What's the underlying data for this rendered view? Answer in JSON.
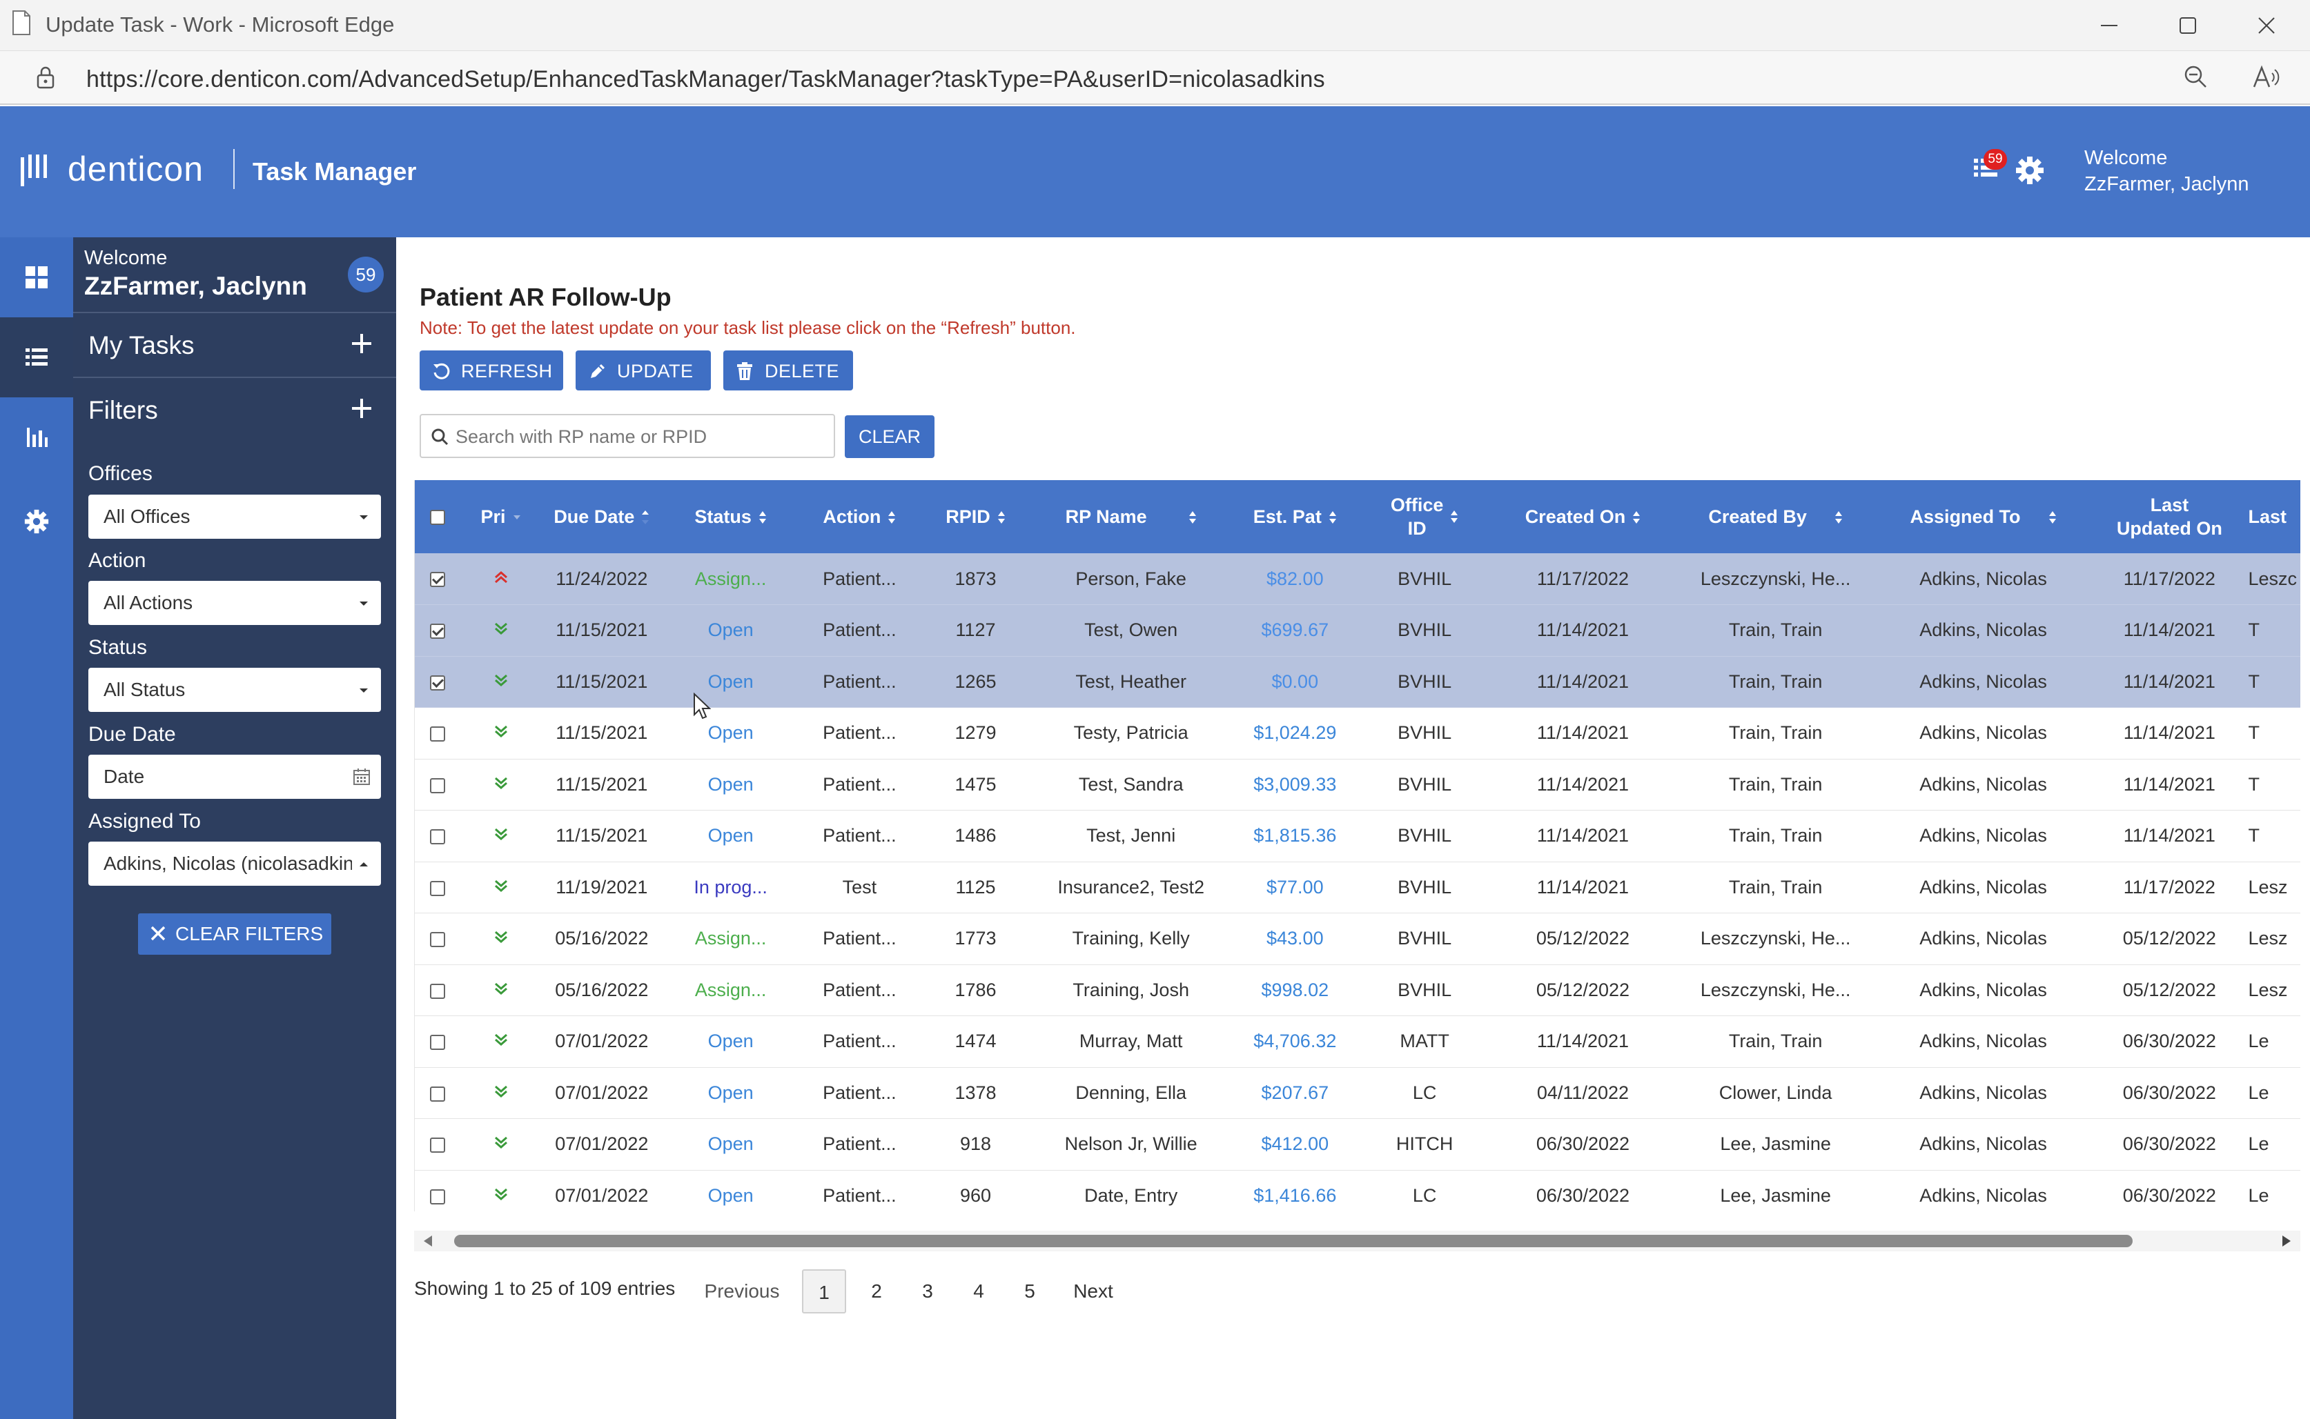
{
  "browser": {
    "window_title": "Update Task - Work - Microsoft Edge",
    "url": "https://core.denticon.com/AdvancedSetup/EnhancedTaskManager/TaskManager?taskType=PA&userID=nicolasadkins"
  },
  "header": {
    "logo_text": "denticon",
    "app_title": "Task Manager",
    "task_badge": "59",
    "welcome_line1": "Welcome",
    "welcome_line2": "ZzFarmer, Jaclynn"
  },
  "sidebar": {
    "welcome": "Welcome",
    "user_name": "ZzFarmer, Jaclynn",
    "count": "59",
    "my_tasks": "My Tasks",
    "filters": "Filters",
    "offices_label": "Offices",
    "offices_value": "All Offices",
    "action_label": "Action",
    "action_value": "All Actions",
    "status_label": "Status",
    "status_value": "All Status",
    "due_date_label": "Due Date",
    "due_date_placeholder": "Date",
    "assigned_label": "Assigned To",
    "assigned_value": "Adkins, Nicolas (nicolasadkins)",
    "clear_filters": "CLEAR FILTERS"
  },
  "main": {
    "title": "Patient AR Follow-Up",
    "note": "Note: To get the latest update on your task list please click on the “Refresh” button.",
    "refresh_label": "REFRESH",
    "update_label": "UPDATE",
    "delete_label": "DELETE",
    "search_placeholder": "Search with RP name or RPID",
    "clear_label": "CLEAR"
  },
  "table": {
    "columns": {
      "pri": "Pri",
      "due_date": "Due Date",
      "status": "Status",
      "action": "Action",
      "rpid": "RPID",
      "rp_name": "RP Name",
      "est_pat": "Est. Pat",
      "office_id_1": "Office",
      "office_id_2": "ID",
      "created_on": "Created On",
      "created_by": "Created By",
      "assigned_to": "Assigned To",
      "last_updated_1": "Last",
      "last_updated_2": "Updated On",
      "last": "Last"
    },
    "rows": [
      {
        "checked": true,
        "priority": "high",
        "due": "11/24/2022",
        "status": "Assign...",
        "status_type": "assign",
        "action": "Patient...",
        "rpid": "1873",
        "name": "Person, Fake",
        "est": "$82.00",
        "office": "BVHIL",
        "created_on": "11/17/2022",
        "created_by": "Leszczynski, He...",
        "assigned": "Adkins, Nicolas",
        "updated": "11/17/2022",
        "last": "Leszc"
      },
      {
        "checked": true,
        "priority": "low",
        "due": "11/15/2021",
        "status": "Open",
        "status_type": "open",
        "action": "Patient...",
        "rpid": "1127",
        "name": "Test, Owen",
        "est": "$699.67",
        "office": "BVHIL",
        "created_on": "11/14/2021",
        "created_by": "Train, Train",
        "assigned": "Adkins, Nicolas",
        "updated": "11/14/2021",
        "last": "T"
      },
      {
        "checked": true,
        "priority": "low",
        "due": "11/15/2021",
        "status": "Open",
        "status_type": "open",
        "action": "Patient...",
        "rpid": "1265",
        "name": "Test, Heather",
        "est": "$0.00",
        "office": "BVHIL",
        "created_on": "11/14/2021",
        "created_by": "Train, Train",
        "assigned": "Adkins, Nicolas",
        "updated": "11/14/2021",
        "last": "T"
      },
      {
        "checked": false,
        "priority": "low",
        "due": "11/15/2021",
        "status": "Open",
        "status_type": "open",
        "action": "Patient...",
        "rpid": "1279",
        "name": "Testy, Patricia",
        "est": "$1,024.29",
        "office": "BVHIL",
        "created_on": "11/14/2021",
        "created_by": "Train, Train",
        "assigned": "Adkins, Nicolas",
        "updated": "11/14/2021",
        "last": "T"
      },
      {
        "checked": false,
        "priority": "low",
        "due": "11/15/2021",
        "status": "Open",
        "status_type": "open",
        "action": "Patient...",
        "rpid": "1475",
        "name": "Test, Sandra",
        "est": "$3,009.33",
        "office": "BVHIL",
        "created_on": "11/14/2021",
        "created_by": "Train, Train",
        "assigned": "Adkins, Nicolas",
        "updated": "11/14/2021",
        "last": "T"
      },
      {
        "checked": false,
        "priority": "low",
        "due": "11/15/2021",
        "status": "Open",
        "status_type": "open",
        "action": "Patient...",
        "rpid": "1486",
        "name": "Test, Jenni",
        "est": "$1,815.36",
        "office": "BVHIL",
        "created_on": "11/14/2021",
        "created_by": "Train, Train",
        "assigned": "Adkins, Nicolas",
        "updated": "11/14/2021",
        "last": "T"
      },
      {
        "checked": false,
        "priority": "low",
        "due": "11/19/2021",
        "status": "In prog...",
        "status_type": "prog",
        "action": "Test",
        "rpid": "1125",
        "name": "Insurance2, Test2",
        "est": "$77.00",
        "office": "BVHIL",
        "created_on": "11/14/2021",
        "created_by": "Train, Train",
        "assigned": "Adkins, Nicolas",
        "updated": "11/17/2022",
        "last": "Lesz"
      },
      {
        "checked": false,
        "priority": "low",
        "due": "05/16/2022",
        "status": "Assign...",
        "status_type": "assign",
        "action": "Patient...",
        "rpid": "1773",
        "name": "Training, Kelly",
        "est": "$43.00",
        "office": "BVHIL",
        "created_on": "05/12/2022",
        "created_by": "Leszczynski, He...",
        "assigned": "Adkins, Nicolas",
        "updated": "05/12/2022",
        "last": "Lesz"
      },
      {
        "checked": false,
        "priority": "low",
        "due": "05/16/2022",
        "status": "Assign...",
        "status_type": "assign",
        "action": "Patient...",
        "rpid": "1786",
        "name": "Training, Josh",
        "est": "$998.02",
        "office": "BVHIL",
        "created_on": "05/12/2022",
        "created_by": "Leszczynski, He...",
        "assigned": "Adkins, Nicolas",
        "updated": "05/12/2022",
        "last": "Lesz"
      },
      {
        "checked": false,
        "priority": "low",
        "due": "07/01/2022",
        "status": "Open",
        "status_type": "open",
        "action": "Patient...",
        "rpid": "1474",
        "name": "Murray, Matt",
        "est": "$4,706.32",
        "office": "MATT",
        "created_on": "11/14/2021",
        "created_by": "Train, Train",
        "assigned": "Adkins, Nicolas",
        "updated": "06/30/2022",
        "last": "Le"
      },
      {
        "checked": false,
        "priority": "low",
        "due": "07/01/2022",
        "status": "Open",
        "status_type": "open",
        "action": "Patient...",
        "rpid": "1378",
        "name": "Denning, Ella",
        "est": "$207.67",
        "office": "LC",
        "created_on": "04/11/2022",
        "created_by": "Clower, Linda",
        "assigned": "Adkins, Nicolas",
        "updated": "06/30/2022",
        "last": "Le"
      },
      {
        "checked": false,
        "priority": "low",
        "due": "07/01/2022",
        "status": "Open",
        "status_type": "open",
        "action": "Patient...",
        "rpid": "918",
        "name": "Nelson Jr, Willie",
        "est": "$412.00",
        "office": "HITCH",
        "created_on": "06/30/2022",
        "created_by": "Lee, Jasmine",
        "assigned": "Adkins, Nicolas",
        "updated": "06/30/2022",
        "last": "Le"
      },
      {
        "checked": false,
        "priority": "low",
        "due": "07/01/2022",
        "status": "Open",
        "status_type": "open",
        "action": "Patient...",
        "rpid": "960",
        "name": "Date, Entry",
        "est": "$1,416.66",
        "office": "LC",
        "created_on": "06/30/2022",
        "created_by": "Lee, Jasmine",
        "assigned": "Adkins, Nicolas",
        "updated": "06/30/2022",
        "last": "Le"
      }
    ]
  },
  "pagination": {
    "showing": "Showing 1 to 25 of 109 entries",
    "previous": "Previous",
    "pages": [
      "1",
      "2",
      "3",
      "4",
      "5"
    ],
    "next": "Next"
  },
  "colors": {
    "header_blue": "#4675c8",
    "sidebar_navy": "#2d3e5f",
    "selected_row": "#b6c2de",
    "status_open": "#3b86d9",
    "status_assigned": "#4cae4c",
    "status_in_progress": "#3a3ac0",
    "note_red": "#c0392b"
  }
}
